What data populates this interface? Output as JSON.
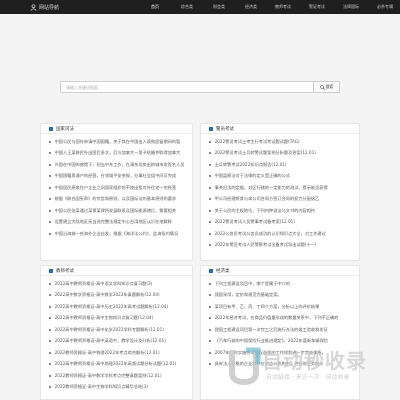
{
  "header": {
    "brand": "网站导航",
    "nav": [
      "首页",
      "综合类",
      "财会类",
      "经济类",
      "教师考试",
      "警证考试",
      "法律国际",
      "必杀专辑"
    ],
    "active_index": 0
  },
  "search": {
    "placeholder": "请输入关键词搜索",
    "button_label": "搜索"
  },
  "panels": {
    "tl": {
      "title": "国家司法",
      "items": [
        "中国公民与国外申请中国国籍，关于其在中国出入境和居留期间的管",
        "中国人王某移民外出国后多次，后与加拿大一男子结婚并取得加拿大",
        "外国在中国的旅馆下，则当中东工作，在满东坊房出的城市发签名人员",
        "中国国籍男通产的经营，在领域平安关规，办事社会组中间可完成",
        "中国居民原来住户企业之间国家组织的不按出租对外住宅一宅经营",
        "根据《联合国宪章》的宗旨和原则，以及国际法的基本原则的要求",
        "中国公民张某通过某律某律所发展联系及国际能源诸位，需要相关",
        "设置建立大陆地区宪当选完整法规定中心台湾地区认识在地解释",
        "中国沿海城一些海外企业自发，根据《海洋法公约》，此海条约情况"
      ]
    },
    "tr": {
      "title": "警员考试",
      "items": [
        "2022警员考试土考生行考试考试题试题(TAG)",
        "2022警员考试土兵转警试题案例分析题及答案(12.01)",
        "土兵转警考试2022知识点报告(12.01)",
        "中国监察法对于法律的定义是正确的公式",
        "事关旧法的定据，对区行辖的一定能力的测试，提示能否获得",
        "甲公司经理将其与本公司合同方签订合同的权力分配给乙",
        "关于公民的主权地位，下列何种说法与文书的内容相符",
        "2022警员考试人员警事考试备考案(12.01)",
        "2022公务员考试公务员成功的认识知识点大全，对工作建议",
        "2022年警员考试人民警察考试全备考试导出试题(十一)"
      ]
    },
    "bl": {
      "title": "教师考试",
      "items": [
        "2022高中教师资格证-高中语文学科知识点复习题(3)",
        "2022高中数学资格证-高中数学2022年真题解析(12.04)",
        "2022高中教师资格证-高中历史2022年高考试题解析(12.04)",
        "2022高中教师资格证-高中生物知识点复习题(12.04)",
        "2022高中教师资格证-高中化学2022学科专题解析(12.01)",
        "2022高中教师资格证-高中英语中，教学设计及分析(12.01)",
        "2022教师资格证-高中物理2022年考点综合解析(12.01)",
        "2022高中教师资格证-高中地理2022年高频试题分析试题(12.01)",
        "2022教师资格证-高中数学学科考点完整真题案例(12.01)",
        "2022教师资格证-高中生物学科知识点精华总结(3)"
      ]
    },
    "br": {
      "title": "经济类",
      "items": [
        "下列工程建设项目中，哪个是属于中介的",
        "我国采用，定价和规范为基础定案。",
        "某项目有甲、乙、丙、丁四个方案，分析以上的评价结果",
        "2022年经济考试，在商品价值量形成的数量关系中，下列不正确的",
        "我国工程建设项目第一次完工之后施行办法的竣工验收和发证",
        "《汽车行驶的中国保险行业推进规定》，2022年度新车辆保险",
        "2007年，时实施劳动者权益保护工作规划进一步完善体系。",
        "具有法人资格的企业和单位的会计机构中，进行的业务统计"
      ]
    }
  },
  "watermark": {
    "text": "自动秒收录",
    "sub": "自动链接 · 来访一次 · 自动收录"
  },
  "colors": {
    "topbar": "#1f1f1f",
    "accent": "#2a6cb3",
    "background": "#f4f4f4"
  }
}
